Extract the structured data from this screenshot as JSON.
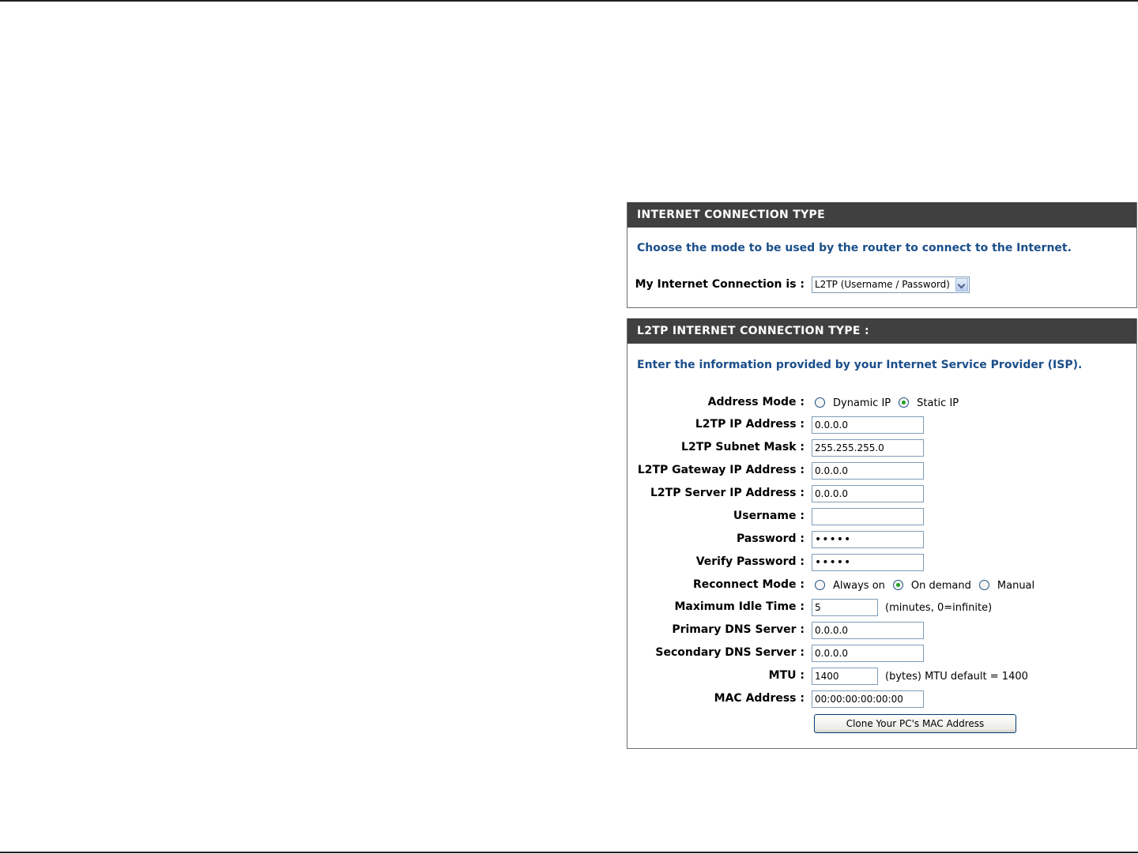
{
  "connection_type": {
    "header": "INTERNET CONNECTION TYPE",
    "intro": "Choose the mode to be used by the router to connect to the Internet.",
    "label": "My Internet Connection is :",
    "selected": "L2TP (Username / Password)"
  },
  "l2tp": {
    "header": "L2TP INTERNET CONNECTION TYPE :",
    "intro": "Enter the information provided by your Internet Service Provider (ISP).",
    "address_mode": {
      "label": "Address Mode :",
      "options": [
        "Dynamic IP",
        "Static IP"
      ],
      "selected": "Static IP"
    },
    "ip_address": {
      "label": "L2TP IP Address :",
      "value": "0.0.0.0"
    },
    "subnet_mask": {
      "label": "L2TP Subnet Mask :",
      "value": "255.255.255.0"
    },
    "gateway": {
      "label": "L2TP Gateway IP Address :",
      "value": "0.0.0.0"
    },
    "server": {
      "label": "L2TP Server IP Address :",
      "value": "0.0.0.0"
    },
    "username": {
      "label": "Username :",
      "value": ""
    },
    "password": {
      "label": "Password :",
      "value": "•••••"
    },
    "verify_password": {
      "label": "Verify Password :",
      "value": "•••••"
    },
    "reconnect_mode": {
      "label": "Reconnect Mode :",
      "options": [
        "Always on",
        "On demand",
        "Manual"
      ],
      "selected": "On demand"
    },
    "idle_time": {
      "label": "Maximum Idle Time :",
      "value": "5",
      "hint": "(minutes, 0=infinite)"
    },
    "primary_dns": {
      "label": "Primary DNS Server :",
      "value": "0.0.0.0"
    },
    "secondary_dns": {
      "label": "Secondary DNS Server :",
      "value": "0.0.0.0"
    },
    "mtu": {
      "label": "MTU :",
      "value": "1400",
      "hint": "(bytes) MTU default = 1400"
    },
    "mac": {
      "label": "MAC Address :",
      "value": "00:00:00:00:00:00"
    },
    "clone_button": "Clone Your PC's MAC Address"
  },
  "colors": {
    "header_bg": "#404040",
    "intro_text": "#1b4f8a",
    "radio_selected": "#21a121"
  }
}
